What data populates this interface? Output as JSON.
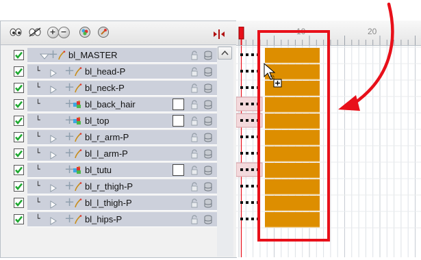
{
  "timeline": {
    "ruler_labels": [
      "10",
      "20"
    ]
  },
  "layers": [
    {
      "name": "bl_MASTER",
      "kind": "peg",
      "depth": 0,
      "expanded": true,
      "checked": true
    },
    {
      "name": "bl_head-P",
      "kind": "peg",
      "depth": 1,
      "expanded": false,
      "checked": true
    },
    {
      "name": "bl_neck-P",
      "kind": "peg",
      "depth": 1,
      "expanded": false,
      "checked": true
    },
    {
      "name": "bl_back_hair",
      "kind": "drawing",
      "depth": 1,
      "checked": true
    },
    {
      "name": "bl_top",
      "kind": "drawing",
      "depth": 1,
      "checked": true
    },
    {
      "name": "bl_r_arm-P",
      "kind": "peg",
      "depth": 1,
      "expanded": false,
      "checked": true
    },
    {
      "name": "bl_l_arm-P",
      "kind": "peg",
      "depth": 1,
      "expanded": false,
      "checked": true
    },
    {
      "name": "bl_tutu",
      "kind": "drawing",
      "depth": 1,
      "checked": true
    },
    {
      "name": "bl_r_thigh-P",
      "kind": "peg",
      "depth": 1,
      "expanded": false,
      "checked": true
    },
    {
      "name": "bl_l_thigh-P",
      "kind": "peg",
      "depth": 1,
      "expanded": false,
      "checked": true
    },
    {
      "name": "bl_hips-P",
      "kind": "peg",
      "depth": 1,
      "expanded": false,
      "checked": true
    }
  ],
  "toolbar": {
    "buttons": [
      "show-all-icon",
      "hide-all-icon",
      "expand-all-icon",
      "collapse-all-icon",
      "add-drawing-layer-icon",
      "add-peg-layer-icon"
    ]
  },
  "colors": {
    "cell_fill": "#dd8e00",
    "highlight_frame": "#e8101a",
    "layer_bar": "#ccd0db"
  }
}
